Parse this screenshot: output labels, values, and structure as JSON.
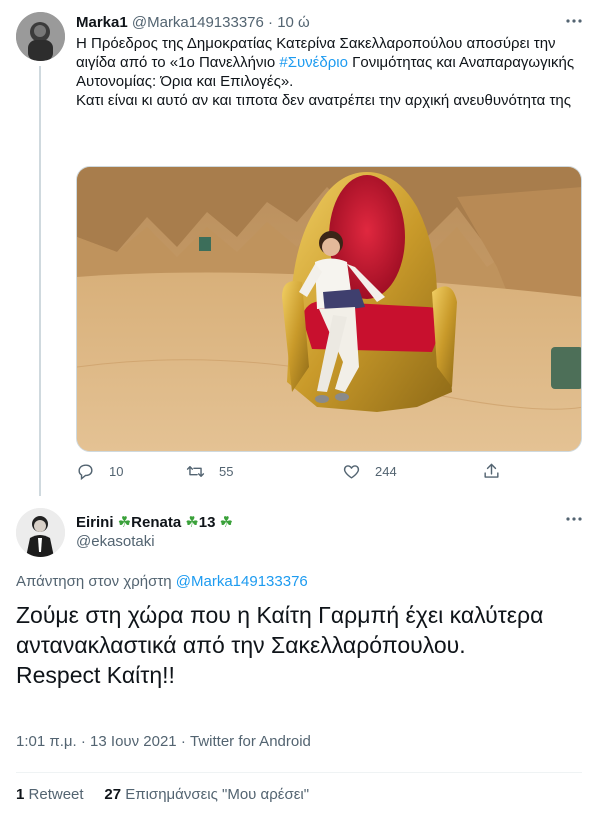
{
  "tweet": {
    "author_name": "Marka1",
    "author_handle": "@Marka149133376",
    "separator": "·",
    "time_ago": "10 ώ",
    "body_line1_prefix": "Η Πρόεδρος της Δημοκρατίας Κατερίνα Σακελλαροπούλου αποσύρει την αιγίδα από το «1ο Πανελλήνιο ",
    "hashtag": "#Συνέδριο",
    "body_line1_suffix": " Γονιμότητας και Αναπαραγωγικής Αυτονομίας: Όρια και Επιλογές».",
    "body_line2": "Κατι είναι κι αυτό αν και τιποτα δεν ανατρέπει  την αρχική ανευθυνότητα της",
    "replies": "10",
    "retweets": "55",
    "likes": "244",
    "icons": [
      "reply-icon",
      "retweet-icon",
      "like-icon",
      "share-icon",
      "more-icon"
    ]
  },
  "reply": {
    "author_name_part1": "Eirini ",
    "clover1": "☘",
    "author_name_part2": "Renata ",
    "clover2": "☘",
    "author_name_part3": "13 ",
    "clover3": "☘",
    "author_handle": "@ekasotaki",
    "replying_to_label": "Απάντηση στον χρήστη ",
    "replying_to_mention": "@Marka149133376",
    "body_line1": "Ζούμε στη χώρα που η Καίτη Γαρμπή έχει καλύτερα αντανακλαστικά από την Σακελλαρόπουλου.",
    "body_line2": "Respect Καίτη!!",
    "time": "1:01 π.μ.",
    "date": "13 Ιουν 2021",
    "source": "Twitter for Android",
    "retweet_count": "1",
    "retweet_label": "Retweet",
    "like_count": "27",
    "like_label": "Επισημάνσεις \"Μου αρέσει\""
  },
  "colors": {
    "link": "#1d9bf0",
    "secondary_text": "#536471",
    "primary_text": "#0f1419",
    "clover": "#3aa13a",
    "sand": "#d6ad74",
    "throne_red": "#c8102e",
    "throne_gold": "#d4a836"
  }
}
